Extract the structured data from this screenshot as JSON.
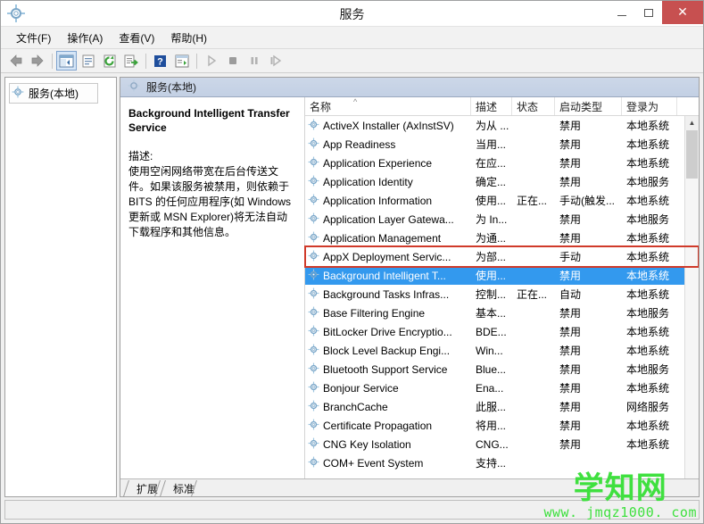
{
  "window": {
    "title": "服务",
    "icon": "services-gear-icon",
    "caption": {
      "minimize_label": "–",
      "maximize_label": "□",
      "close_label": "✕",
      "close_color": "#c75050"
    }
  },
  "menubar": {
    "items": [
      {
        "label": "文件(F)",
        "name": "menu-file"
      },
      {
        "label": "操作(A)",
        "name": "menu-action"
      },
      {
        "label": "查看(V)",
        "name": "menu-view"
      },
      {
        "label": "帮助(H)",
        "name": "menu-help"
      }
    ]
  },
  "toolbar": {
    "buttons": [
      {
        "name": "back-arrow-icon",
        "enabled": true
      },
      {
        "name": "forward-arrow-icon",
        "enabled": true
      },
      {
        "name": "show-hide-tree-icon",
        "enabled": true,
        "pressed": true
      },
      {
        "name": "properties-icon",
        "enabled": true
      },
      {
        "name": "refresh-icon",
        "enabled": true
      },
      {
        "name": "export-list-icon",
        "enabled": true
      },
      {
        "name": "help-icon",
        "enabled": true
      },
      {
        "name": "show-action-pane-icon",
        "enabled": true
      },
      {
        "name": "start-service-icon",
        "enabled": false
      },
      {
        "name": "stop-service-icon",
        "enabled": false
      },
      {
        "name": "pause-service-icon",
        "enabled": false
      },
      {
        "name": "restart-service-icon",
        "enabled": false
      }
    ]
  },
  "tree": {
    "root_label": "服务(本地)",
    "root_icon": "services-gear-icon"
  },
  "pane": {
    "header_label": "服务(本地)",
    "header_icon": "services-gear-icon"
  },
  "detail": {
    "service_title": "Background Intelligent Transfer Service",
    "description_label": "描述:",
    "description_body": "使用空闲网络带宽在后台传送文件。如果该服务被禁用，则依赖于 BITS 的任何应用程序(如 Windows 更新或 MSN Explorer)将无法自动下载程序和其他信息。"
  },
  "list": {
    "columns": [
      {
        "label": "名称",
        "name": "column-name",
        "sorted": "asc"
      },
      {
        "label": "描述",
        "name": "column-description"
      },
      {
        "label": "状态",
        "name": "column-status"
      },
      {
        "label": "启动类型",
        "name": "column-startup-type"
      },
      {
        "label": "登录为",
        "name": "column-log-on-as"
      }
    ],
    "sort_caret": "^",
    "selected_index": 8,
    "rows": [
      {
        "name": "ActiveX Installer (AxInstSV)",
        "description": "为从 ...",
        "status": "",
        "startup": "禁用",
        "logon": "本地系统"
      },
      {
        "name": "App Readiness",
        "description": "当用...",
        "status": "",
        "startup": "禁用",
        "logon": "本地系统"
      },
      {
        "name": "Application Experience",
        "description": "在应...",
        "status": "",
        "startup": "禁用",
        "logon": "本地系统"
      },
      {
        "name": "Application Identity",
        "description": "确定...",
        "status": "",
        "startup": "禁用",
        "logon": "本地服务"
      },
      {
        "name": "Application Information",
        "description": "使用...",
        "status": "正在...",
        "startup": "手动(触发...",
        "logon": "本地系统"
      },
      {
        "name": "Application Layer Gatewa...",
        "description": "为 In...",
        "status": "",
        "startup": "禁用",
        "logon": "本地服务"
      },
      {
        "name": "Application Management",
        "description": "为通...",
        "status": "",
        "startup": "禁用",
        "logon": "本地系统"
      },
      {
        "name": "AppX Deployment Servic...",
        "description": "为部...",
        "status": "",
        "startup": "手动",
        "logon": "本地系统"
      },
      {
        "name": "Background Intelligent T...",
        "description": "使用...",
        "status": "",
        "startup": "禁用",
        "logon": "本地系统"
      },
      {
        "name": "Background Tasks Infras...",
        "description": "控制...",
        "status": "正在...",
        "startup": "自动",
        "logon": "本地系统"
      },
      {
        "name": "Base Filtering Engine",
        "description": "基本...",
        "status": "",
        "startup": "禁用",
        "logon": "本地服务"
      },
      {
        "name": "BitLocker Drive Encryptio...",
        "description": "BDE...",
        "status": "",
        "startup": "禁用",
        "logon": "本地系统"
      },
      {
        "name": "Block Level Backup Engi...",
        "description": "Win...",
        "status": "",
        "startup": "禁用",
        "logon": "本地系统"
      },
      {
        "name": "Bluetooth Support Service",
        "description": "Blue...",
        "status": "",
        "startup": "禁用",
        "logon": "本地服务"
      },
      {
        "name": "Bonjour Service",
        "description": "Ena...",
        "status": "",
        "startup": "禁用",
        "logon": "本地系统"
      },
      {
        "name": "BranchCache",
        "description": "此服...",
        "status": "",
        "startup": "禁用",
        "logon": "网络服务"
      },
      {
        "name": "Certificate Propagation",
        "description": "将用...",
        "status": "",
        "startup": "禁用",
        "logon": "本地系统"
      },
      {
        "name": "CNG Key Isolation",
        "description": "CNG...",
        "status": "",
        "startup": "禁用",
        "logon": "本地系统"
      },
      {
        "name": "COM+ Event System",
        "description": "支持...",
        "status": "",
        "startup": "",
        "logon": ""
      }
    ],
    "row_icon": "service-gear-icon",
    "selection_color": "#3399ee",
    "highlight_box_color": "#d03a2a"
  },
  "scrollbar": {
    "up_arrow": "▲",
    "down_arrow": "▼",
    "name": "list-vertical-scrollbar"
  },
  "tabs": [
    {
      "label": "扩展",
      "name": "tab-extended",
      "active": false
    },
    {
      "label": "标准",
      "name": "tab-standard",
      "active": true
    }
  ],
  "watermark": {
    "text": "学知网",
    "url": "www. jmqz1000. com",
    "color": "#3fe03f"
  }
}
